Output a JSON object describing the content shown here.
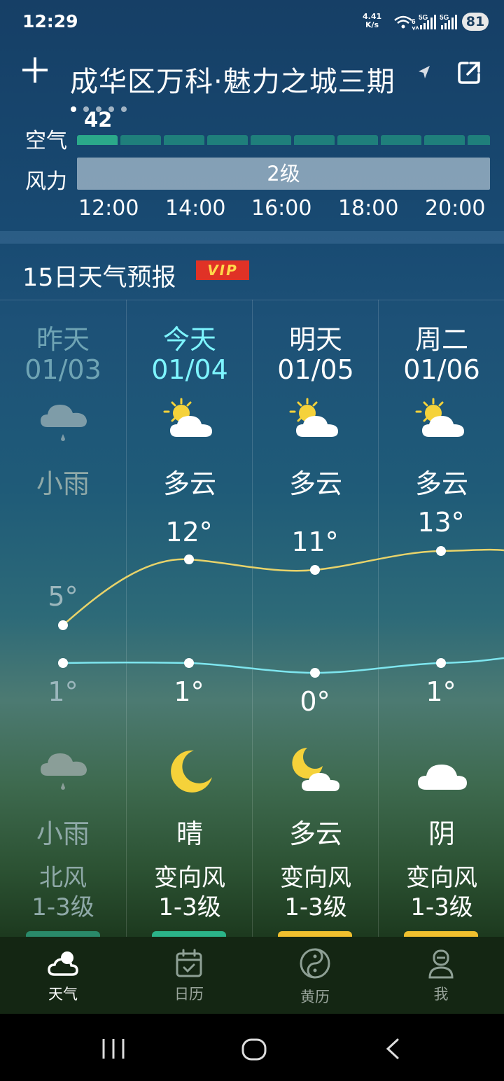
{
  "status_bar": {
    "time": "12:29",
    "net_speed_value": "4.41",
    "net_speed_unit": "K/s",
    "wifi_label": "6",
    "sim1_label": "5G",
    "sim2_label": "5G",
    "battery": "81"
  },
  "header": {
    "location": "成华区万科·魅力之城三期",
    "page_dots": 5,
    "active_dot": 0
  },
  "hourly": {
    "air_label": "空气",
    "aqi_value": "42",
    "wind_label": "力",
    "wind_label_full": "风力",
    "wind_value": "2级",
    "hours": [
      "12:00",
      "14:00",
      "16:00",
      "18:00",
      "20:00"
    ]
  },
  "forecast": {
    "title": "15日天气预报",
    "vip_badge": "VIP",
    "days": [
      {
        "day": "昨天",
        "date": "01/03",
        "day_icon": "rain-icon",
        "day_cond": "小雨",
        "high": "5°",
        "low": "1°",
        "night_icon": "rain-icon",
        "night_cond": "小雨",
        "wind_dir": "北风",
        "wind_level": "1-3级"
      },
      {
        "day": "今天",
        "date": "01/04",
        "day_icon": "partly-cloudy-day-icon",
        "day_cond": "多云",
        "high": "12°",
        "low": "1°",
        "night_icon": "moon-icon",
        "night_cond": "晴",
        "wind_dir": "变向风",
        "wind_level": "1-3级"
      },
      {
        "day": "明天",
        "date": "01/05",
        "day_icon": "partly-cloudy-day-icon",
        "day_cond": "多云",
        "high": "11°",
        "low": "0°",
        "night_icon": "partly-cloudy-night-icon",
        "night_cond": "多云",
        "wind_dir": "变向风",
        "wind_level": "1-3级"
      },
      {
        "day": "周二",
        "date": "01/06",
        "day_icon": "partly-cloudy-day-icon",
        "day_cond": "多云",
        "high": "13°",
        "low": "1°",
        "night_icon": "cloud-icon",
        "night_cond": "阴",
        "wind_dir": "变向风",
        "wind_level": "1-3级"
      }
    ],
    "high_line_color": "#e8d36a",
    "low_line_color": "#7ee6ef",
    "aqi_pill_colors": [
      "#2a8a6a",
      "#2bb489",
      "#f0c02e",
      "#f0c02e"
    ]
  },
  "tabbar": {
    "tabs": [
      {
        "label": "天气",
        "icon": "weather-cloud-icon",
        "active": true
      },
      {
        "label": "日历",
        "icon": "calendar-icon",
        "active": false
      },
      {
        "label": "黄历",
        "icon": "yin-yang-icon",
        "active": false
      },
      {
        "label": "我",
        "icon": "person-icon",
        "active": false
      }
    ]
  },
  "system_nav": {
    "recents": "recents-icon",
    "home": "home-icon",
    "back": "back-icon"
  }
}
